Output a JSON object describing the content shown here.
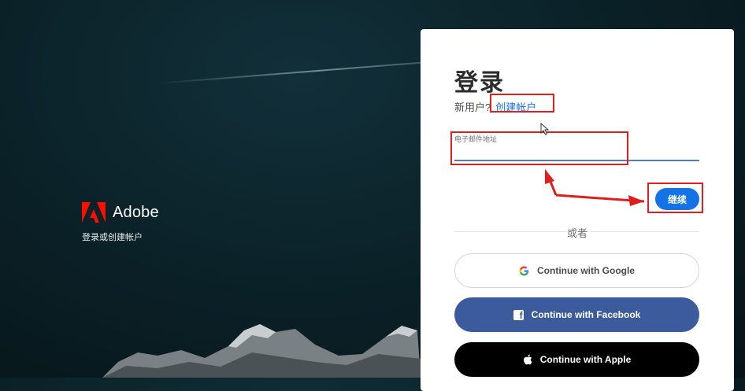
{
  "brand": {
    "name": "Adobe",
    "tagline": "登录或创建帐户"
  },
  "signin": {
    "title": "登录",
    "new_user_prompt": "新用户?",
    "create_account_link": "创建帐户",
    "email_label": "电子邮件地址",
    "email_value": "",
    "continue_label": "继续",
    "or_label": "或者"
  },
  "social": {
    "google_label": "Continue with Google",
    "facebook_label": "Continue with Facebook",
    "apple_label": "Continue with Apple"
  },
  "colors": {
    "accent": "#1473e6",
    "facebook": "#3b5b9d",
    "apple": "#000000",
    "annotation": "#e01e1e",
    "adobe_red": "#fa0f00"
  }
}
